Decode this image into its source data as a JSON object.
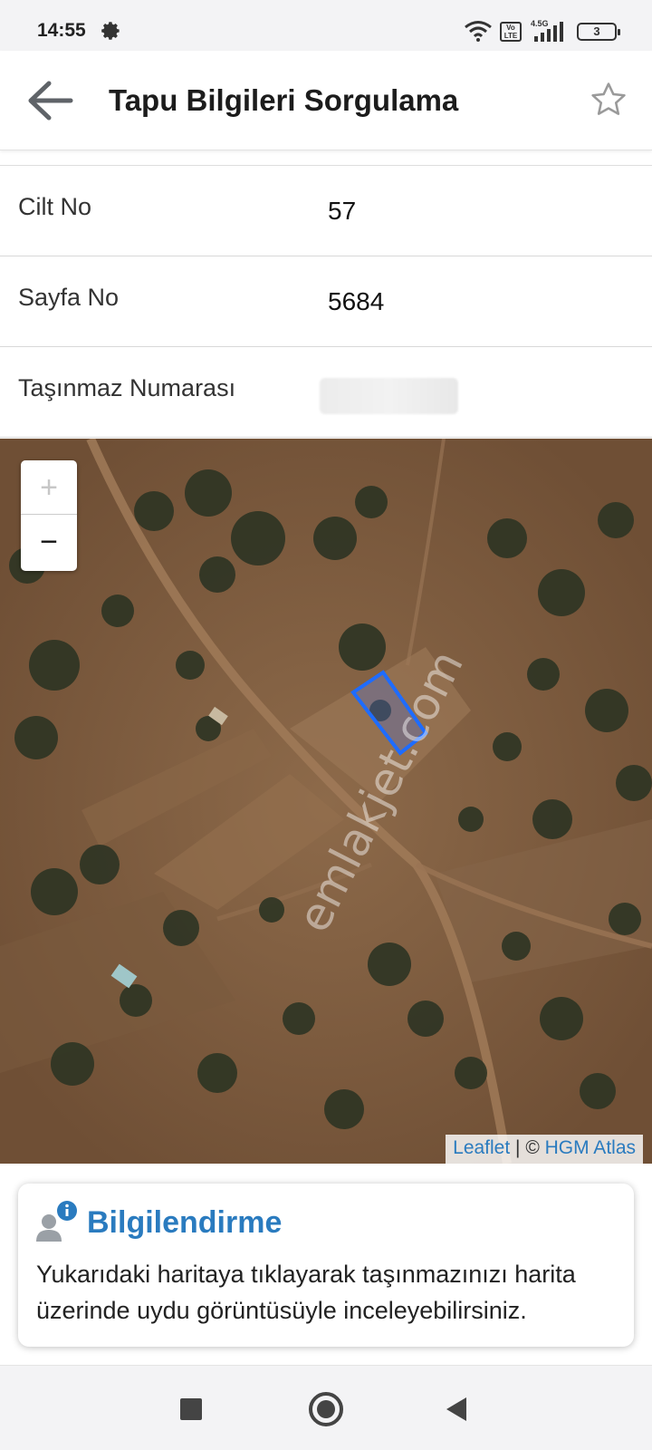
{
  "status_bar": {
    "time": "14:55",
    "network": "4.5G",
    "volte": "Vo LTE",
    "battery": "3",
    "icons": [
      "settings-gear-icon",
      "wifi-icon",
      "volte-icon",
      "signal-icon",
      "battery-icon"
    ]
  },
  "app_bar": {
    "title": "Tapu Bilgileri Sorgulama",
    "back_icon": "arrow-left-icon",
    "favorite_icon": "star-outline-icon"
  },
  "rows": [
    {
      "label": "Cilt No",
      "value": "57"
    },
    {
      "label": "Sayfa No",
      "value": "5684"
    },
    {
      "label": "Taşınmaz Numarası",
      "value": ""
    }
  ],
  "map": {
    "zoom_in": "+",
    "zoom_out": "−",
    "watermark": "emlakjet.com",
    "attribution": {
      "leaflet": "Leaflet",
      "separator": " | © ",
      "provider": "HGM Atlas"
    },
    "parcel_color": "#1e6cff"
  },
  "info_card": {
    "title": "Bilgilendirme",
    "body": "Yukarıdaki haritaya tıklayarak taşınmazınızı harita üzerinde uydu görüntüsüyle inceleyebilirsiniz.",
    "icon": "user-info-icon",
    "accent": "#2a7bbf"
  },
  "nav_bar": {
    "buttons": [
      "recents-square-icon",
      "home-circle-icon",
      "back-triangle-icon"
    ]
  }
}
